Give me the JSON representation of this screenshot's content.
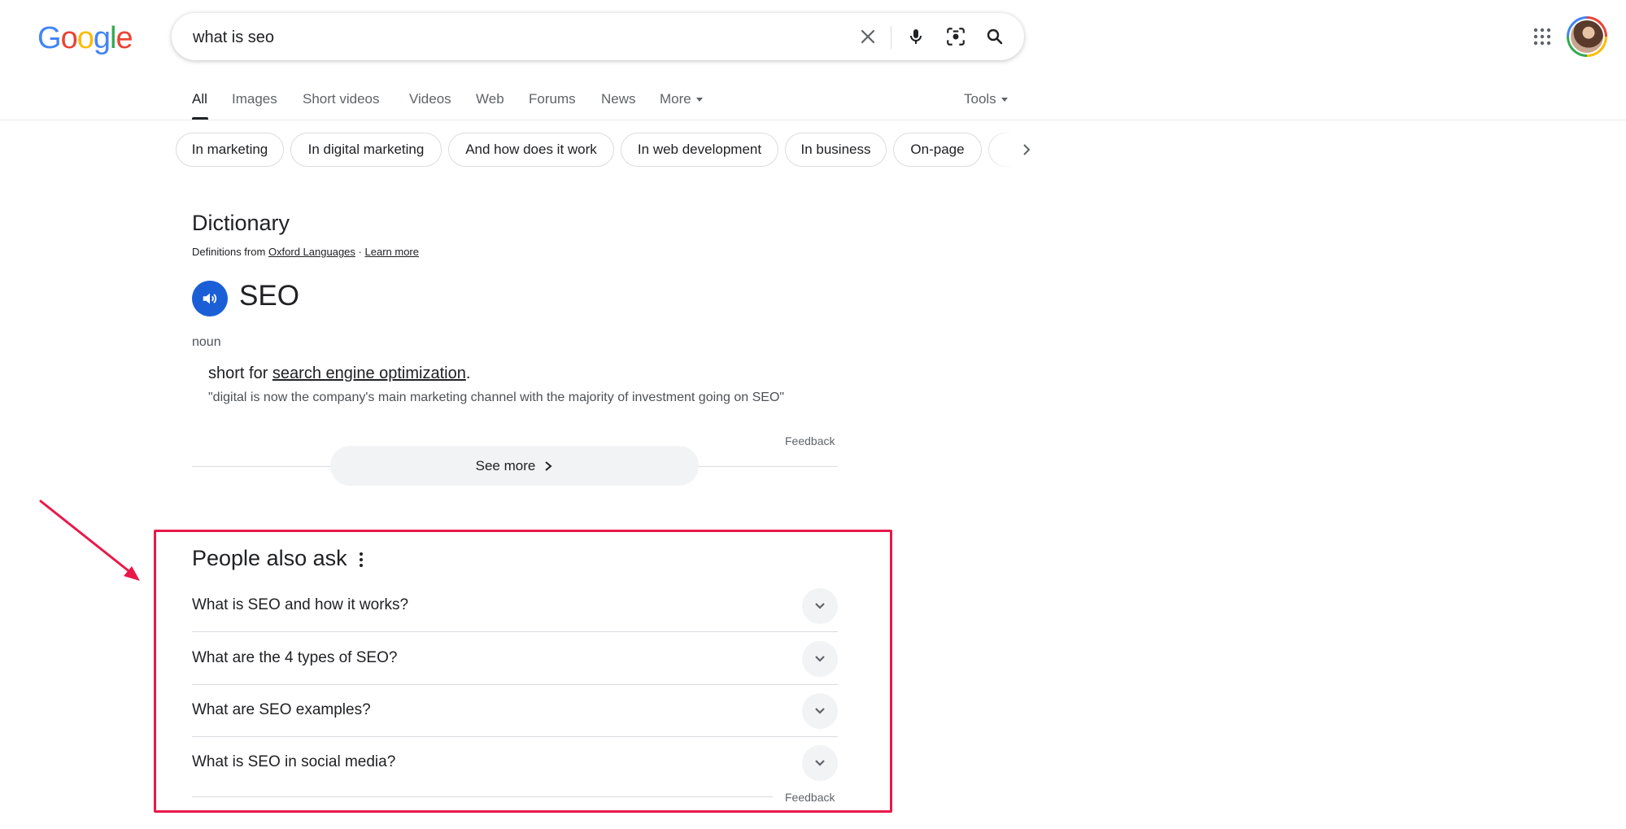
{
  "logo": {
    "letters": [
      "G",
      "o",
      "o",
      "g",
      "l",
      "e"
    ],
    "colors": [
      "#4285f4",
      "#ea4335",
      "#fbbc04",
      "#4285f4",
      "#34a853",
      "#ea4335"
    ]
  },
  "search": {
    "query": "what is seo"
  },
  "icons": {
    "clear": "close-icon",
    "voice": "microphone-icon",
    "lens": "camera-lens-icon",
    "search": "search-icon",
    "apps": "apps-grid-icon"
  },
  "tabs": [
    {
      "label": "All",
      "active": true
    },
    {
      "label": "Images"
    },
    {
      "label": "Short videos"
    },
    {
      "label": "Videos"
    },
    {
      "label": "Web"
    },
    {
      "label": "Forums"
    },
    {
      "label": "News"
    },
    {
      "label": "More"
    }
  ],
  "tools_label": "Tools",
  "chips": [
    "In marketing",
    "In digital marketing",
    "And how does it work",
    "In web development",
    "In business",
    "On-page"
  ],
  "dictionary": {
    "title": "Dictionary",
    "source_prefix": "Definitions from",
    "source_link": "Oxford Languages",
    "separator": "·",
    "learn_more": "Learn more",
    "word": "SEO",
    "part_of_speech": "noun",
    "definition_prefix": "short for",
    "definition_link": "search engine optimization",
    "definition_suffix": ".",
    "example": "\"digital is now the company's main marketing channel with the majority of investment going on SEO\"",
    "feedback": "Feedback",
    "see_more": "See more"
  },
  "people_also_ask": {
    "title": "People also ask",
    "questions": [
      "What is SEO and how it works?",
      "What are the 4 types of SEO?",
      "What are SEO examples?",
      "What is SEO in social media?"
    ],
    "feedback": "Feedback"
  },
  "annotation": {
    "color": "#e8194a"
  }
}
